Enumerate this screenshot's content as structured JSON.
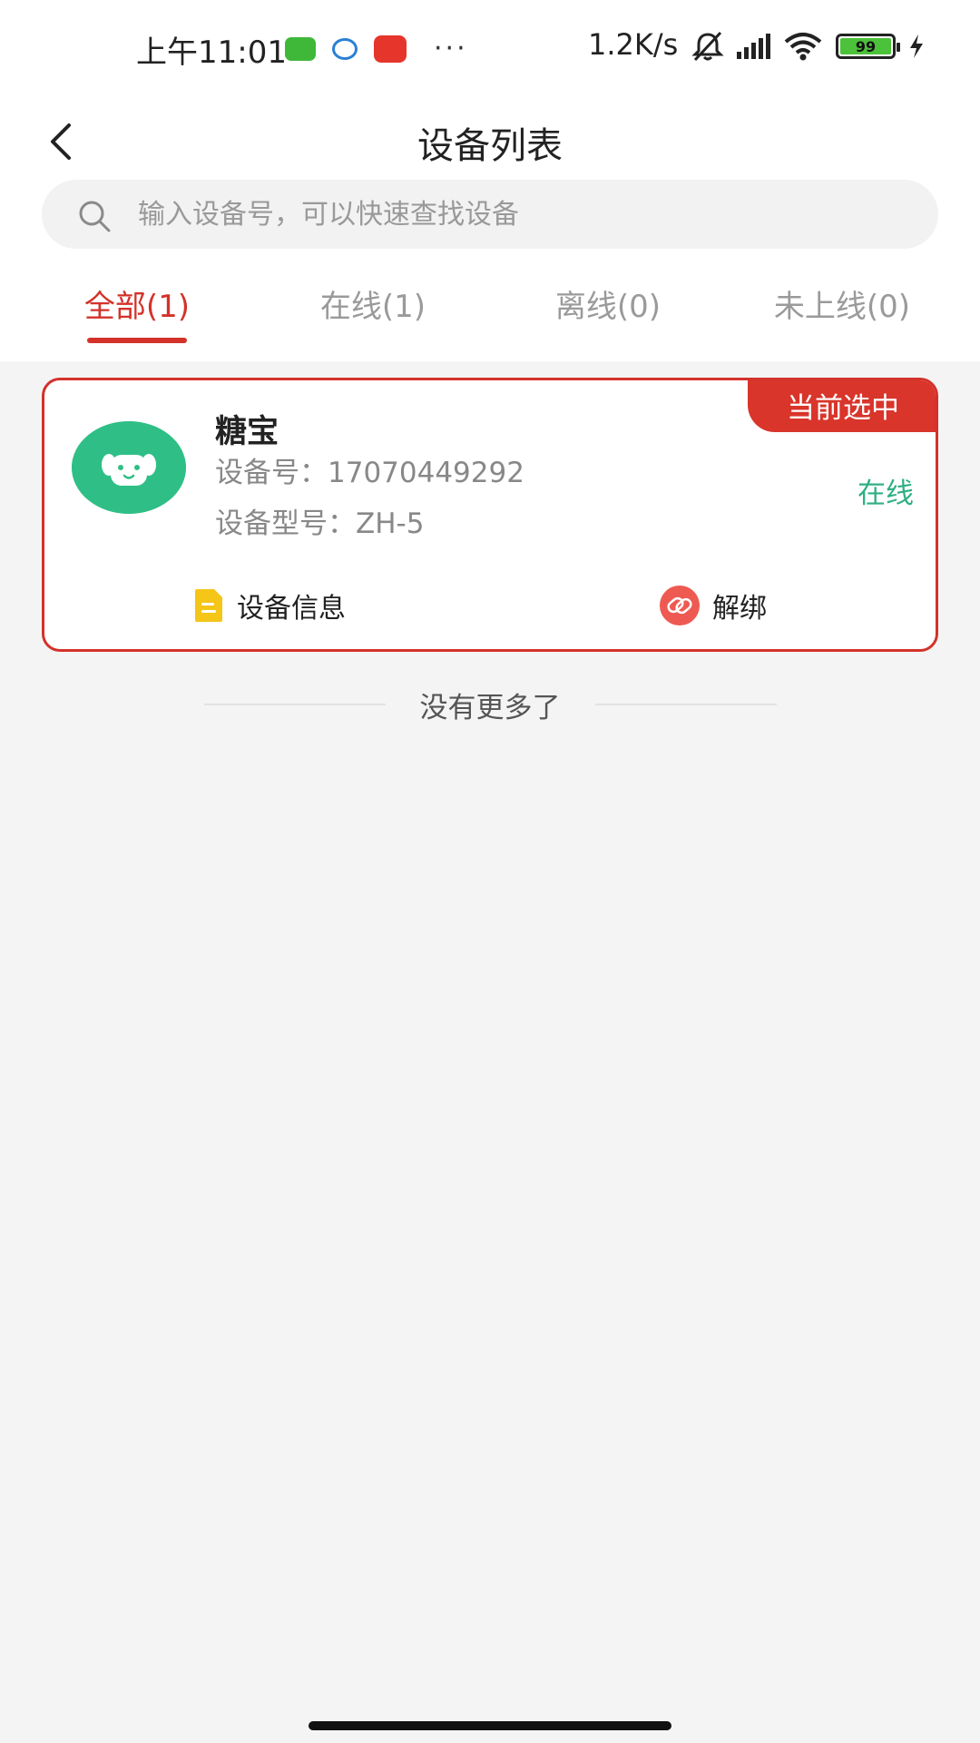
{
  "status_bar": {
    "time": "上午11:01",
    "network_speed": "1.2K/s",
    "battery_level": "99",
    "more_dots": "···"
  },
  "header": {
    "title": "设备列表"
  },
  "search": {
    "placeholder": "输入设备号，可以快速查找设备"
  },
  "tabs": [
    {
      "label": "全部(1)",
      "active": true
    },
    {
      "label": "在线(1)",
      "active": false
    },
    {
      "label": "离线(0)",
      "active": false
    },
    {
      "label": "未上线(0)",
      "active": false
    }
  ],
  "device": {
    "name": "糖宝",
    "id_text": "设备号：17070449292",
    "model_text": "设备型号：ZH-5",
    "status": "在线",
    "badge": "当前选中",
    "info_action": "设备信息",
    "unbind_action": "解绑"
  },
  "footer": {
    "no_more": "没有更多了"
  },
  "colors": {
    "accent": "#d3322a",
    "online": "#2faf84",
    "avatar": "#2fbf86",
    "background": "#f4f4f4"
  }
}
